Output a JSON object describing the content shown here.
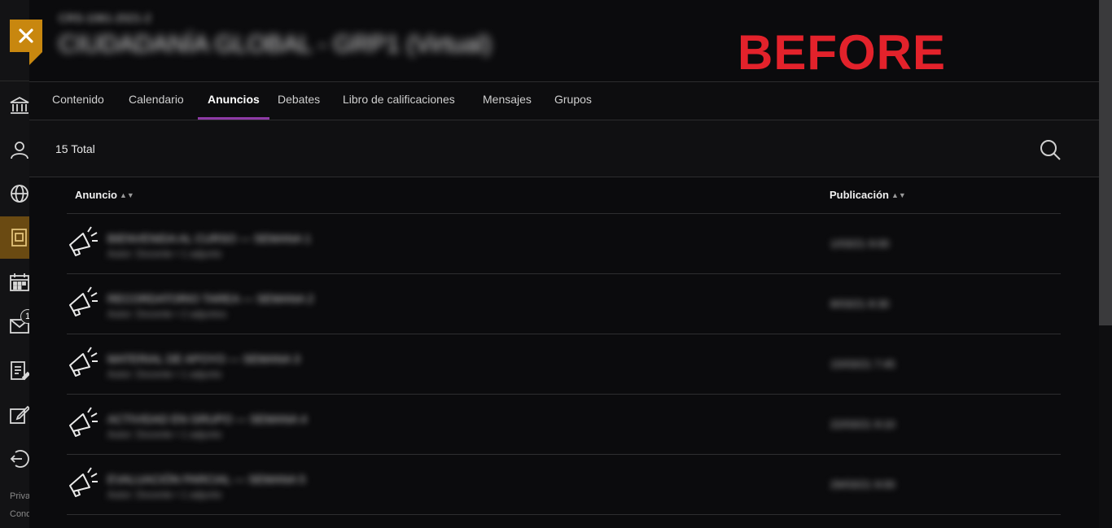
{
  "header": {
    "course_subtitle": "CRS-1061-2021-2",
    "course_title": "CIUDADANÍA GLOBAL - GRP1 (Virtual)",
    "overlay_label": "BEFORE"
  },
  "tabs": [
    {
      "label": "Contenido"
    },
    {
      "label": "Calendario"
    },
    {
      "label": "Anuncios"
    },
    {
      "label": "Debates"
    },
    {
      "label": "Libro de calificaciones"
    },
    {
      "label": "Mensajes"
    },
    {
      "label": "Grupos"
    }
  ],
  "active_tab": "Anuncios",
  "toolbar": {
    "total_label": "15 Total"
  },
  "table": {
    "col_announcement": "Anuncio",
    "col_published": "Publicación",
    "rows": [
      {
        "title": "BIENVENIDA AL CURSO — SEMANA 1",
        "meta": "Autor: Docente • 1 adjunto",
        "date": "1/03/21 9:00"
      },
      {
        "title": "RECORDATORIO TAREA — SEMANA 2",
        "meta": "Autor: Docente • 2 adjuntos",
        "date": "8/03/21 8:30"
      },
      {
        "title": "MATERIAL DE APOYO — SEMANA 3",
        "meta": "Autor: Docente • 1 adjunto",
        "date": "15/03/21 7:45"
      },
      {
        "title": "ACTIVIDAD EN GRUPO — SEMANA 4",
        "meta": "Autor: Docente • 1 adjunto",
        "date": "22/03/21 9:10"
      },
      {
        "title": "EVALUACIÓN PARCIAL — SEMANA 5",
        "meta": "Autor: Docente • 1 adjunto",
        "date": "29/03/21 9:00"
      }
    ]
  },
  "rail": {
    "badge": "1",
    "footer_privacy": "Privacidad",
    "footer_conditions": "Condiciones"
  },
  "colors": {
    "accent_tab": "#8e3aa6",
    "close_flag": "#c8870f",
    "overlay_text": "#e3222b"
  }
}
